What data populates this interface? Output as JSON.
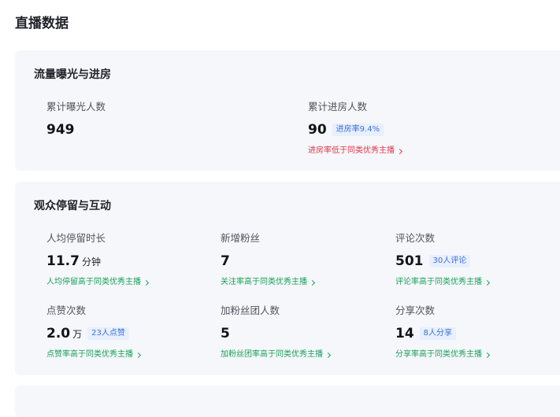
{
  "page": {
    "title": "直播数据"
  },
  "traffic": {
    "title": "流量曝光与进房",
    "exposure": {
      "label": "累计曝光人数",
      "value": "949"
    },
    "entry": {
      "label": "累计进房人数",
      "value": "90",
      "badge": "进房率9.4%",
      "hint": "进房率低于同类优秀主播",
      "hint_color": "#e0354a"
    }
  },
  "engagement": {
    "title": "观众停留与互动",
    "metrics": [
      {
        "label": "人均停留时长",
        "value": "11.7",
        "unit": "分钟",
        "badge": "",
        "hint": "人均停留高于同类优秀主播"
      },
      {
        "label": "新增粉丝",
        "value": "7",
        "unit": "",
        "badge": "",
        "hint": "关注率高于同类优秀主播"
      },
      {
        "label": "评论次数",
        "value": "501",
        "unit": "",
        "badge": "30人评论",
        "hint": "评论率高于同类优秀主播"
      },
      {
        "label": "点赞次数",
        "value": "2.0",
        "unit": "万",
        "badge": "23人点赞",
        "hint": "点赞率高于同类优秀主播"
      },
      {
        "label": "加粉丝团人数",
        "value": "5",
        "unit": "",
        "badge": "",
        "hint": "加粉丝团率高于同类优秀主播"
      },
      {
        "label": "分享次数",
        "value": "14",
        "unit": "",
        "badge": "8人分享",
        "hint": "分享率高于同类优秀主播"
      }
    ],
    "hint_color": "#1aa05a"
  },
  "colors": {
    "card_background": "#f5f7fa",
    "badge_background": "#e8f0fe",
    "badge_text": "#3d6fd8"
  }
}
